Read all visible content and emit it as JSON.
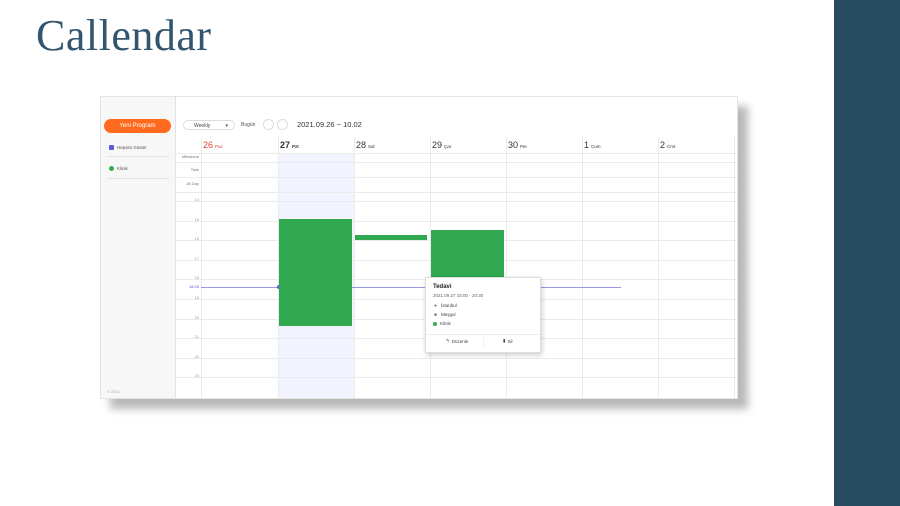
{
  "slide": {
    "title": "Callendar"
  },
  "colors": {
    "accent": "#ff6a1f",
    "event": "#2fa84f",
    "band": "#264a60",
    "title": "#33566e"
  },
  "sidebar": {
    "new_button": "Yeni Program",
    "calendars": [
      {
        "label": "Hepsini Göster",
        "icon": "checkbox-checked-icon"
      },
      {
        "label": "Klinik",
        "icon": "green-dot-icon"
      }
    ],
    "copyright": "© 2021"
  },
  "toolbar": {
    "view": "Weekly",
    "today": "Bugün",
    "range": "2021.09.26 ~ 10.02"
  },
  "days": [
    {
      "num": "26",
      "label": "Paz"
    },
    {
      "num": "27",
      "label": "Pzt"
    },
    {
      "num": "28",
      "label": "Sal"
    },
    {
      "num": "29",
      "label": "Çar"
    },
    {
      "num": "30",
      "label": "Per"
    },
    {
      "num": "1",
      "label": "Cum"
    },
    {
      "num": "2",
      "label": "Cmt"
    }
  ],
  "all_day_rows": [
    "Milestone",
    "Task",
    "All Day"
  ],
  "hours": [
    "14",
    "15",
    "16",
    "17",
    "18",
    "19",
    "20",
    "21",
    "22",
    "23"
  ],
  "now_label": "18:26",
  "popup": {
    "title": "Tedavi",
    "time": "2021.09.27 15:00 - 20:30",
    "location": "İstanbul",
    "state": "Meşgul",
    "calendar": "Klinik",
    "edit": "Düzenle",
    "delete": "Sil"
  }
}
